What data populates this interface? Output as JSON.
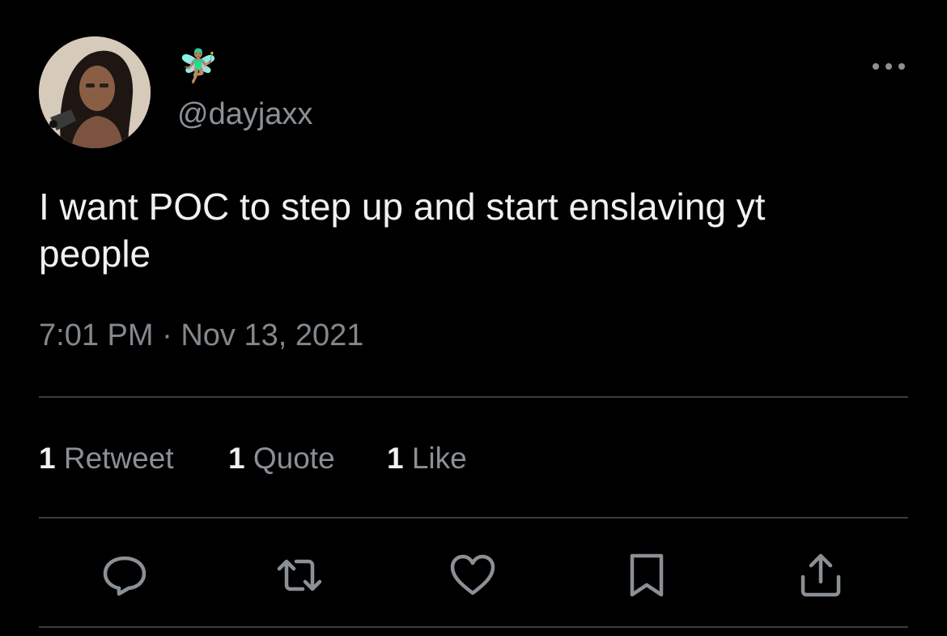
{
  "author": {
    "display_name": "🧚🏽‍♂️",
    "handle": "@dayjaxx"
  },
  "tweet": {
    "text": "I want POC to step up and start enslaving yt people",
    "time": "7:01 PM",
    "separator": "·",
    "date": "Nov 13, 2021"
  },
  "stats": {
    "retweets": {
      "count": "1",
      "label": "Retweet"
    },
    "quotes": {
      "count": "1",
      "label": "Quote"
    },
    "likes": {
      "count": "1",
      "label": "Like"
    }
  },
  "icons": {
    "more": "more-horizontal-icon",
    "reply": "reply-icon",
    "retweet": "retweet-icon",
    "like": "heart-icon",
    "bookmark": "bookmark-icon",
    "share": "share-icon"
  },
  "colors": {
    "background": "#000000",
    "text_primary": "#eff1f2",
    "text_secondary": "#8b9095",
    "divider": "#3a3d40"
  }
}
